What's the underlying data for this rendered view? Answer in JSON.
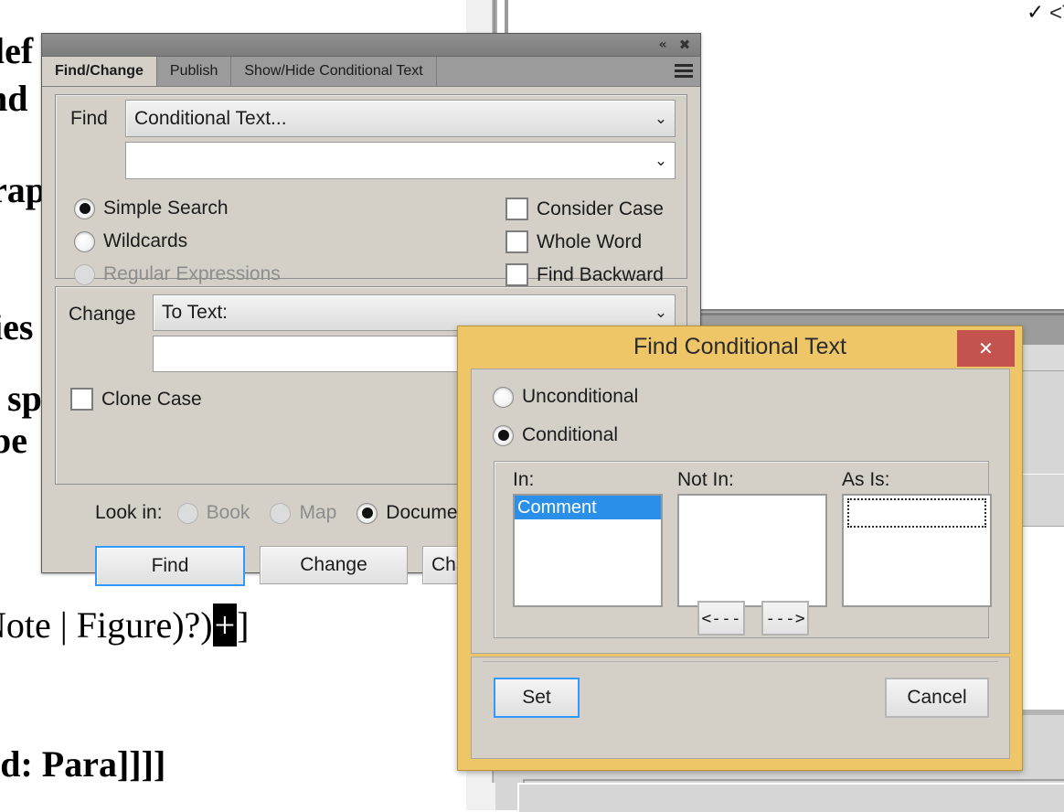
{
  "document_background": {
    "text_fragments": [
      "lef",
      "nd",
      "rap",
      "ies",
      ", sp",
      "be",
      "Note | Figure)?)",
      "ild: Para]]]]"
    ],
    "caret_glyph": "+",
    "text_marker": {
      "check": "✓",
      "label": "<TEXT>"
    }
  },
  "find_change_panel": {
    "titlebar": {
      "collapse_icon": "«",
      "close_icon": "✖"
    },
    "tabs": [
      {
        "label": "Find/Change",
        "active": true
      },
      {
        "label": "Publish",
        "active": false
      },
      {
        "label": "Show/Hide Conditional Text",
        "active": false
      }
    ],
    "menu_icon": "hamburger-icon",
    "find_section": {
      "label": "Find",
      "combo_value": "Conditional Text...",
      "chevron": "⌄",
      "text_value": "",
      "radios": [
        {
          "label": "Simple Search",
          "checked": true,
          "disabled": false
        },
        {
          "label": "Wildcards",
          "checked": false,
          "disabled": false
        },
        {
          "label": "Regular Expressions",
          "checked": false,
          "disabled": true
        }
      ],
      "checkboxes": [
        {
          "label": "Consider Case",
          "checked": false
        },
        {
          "label": "Whole Word",
          "checked": false
        },
        {
          "label": "Find Backward",
          "checked": false
        }
      ]
    },
    "change_section": {
      "label": "Change",
      "combo_value": "To Text:",
      "chevron": "⌄",
      "text_value": "",
      "checkboxes": [
        {
          "label": "Clone Case",
          "checked": false
        }
      ]
    },
    "look_in": {
      "label": "Look in:",
      "options": [
        {
          "label": "Book",
          "checked": false,
          "disabled": true
        },
        {
          "label": "Map",
          "checked": false,
          "disabled": true
        },
        {
          "label": "Document",
          "checked": true,
          "disabled": false
        }
      ]
    },
    "buttons": [
      {
        "label": "Find",
        "default": true
      },
      {
        "label": "Change",
        "default": false
      },
      {
        "label": "Change All",
        "default": false
      }
    ]
  },
  "find_conditional_text_dialog": {
    "title": "Find Conditional Text",
    "close_icon": "✕",
    "mode_radios": [
      {
        "label": "Unconditional",
        "checked": false
      },
      {
        "label": "Conditional",
        "checked": true
      }
    ],
    "columns": [
      {
        "label": "In:",
        "items": [
          "Comment"
        ],
        "selected": "Comment",
        "focused": false
      },
      {
        "label": "Not In:",
        "items": [],
        "selected": "",
        "focused": false
      },
      {
        "label": "As Is:",
        "items": [],
        "selected": "",
        "focused": true
      }
    ],
    "move_buttons": [
      {
        "label": "<---",
        "name": "move-left"
      },
      {
        "label": "--->",
        "name": "move-right"
      }
    ],
    "footer_buttons": [
      {
        "label": "Set",
        "default": true
      },
      {
        "label": "Cancel",
        "default": false
      }
    ]
  },
  "colors": {
    "dialog_accent": "#eec668",
    "close_red": "#c4534f",
    "selection_blue": "#2a8fe8",
    "focus_blue": "#3399ff",
    "panel_gray": "#d4d0c8",
    "tabstrip_gray": "#9b9b9b"
  }
}
